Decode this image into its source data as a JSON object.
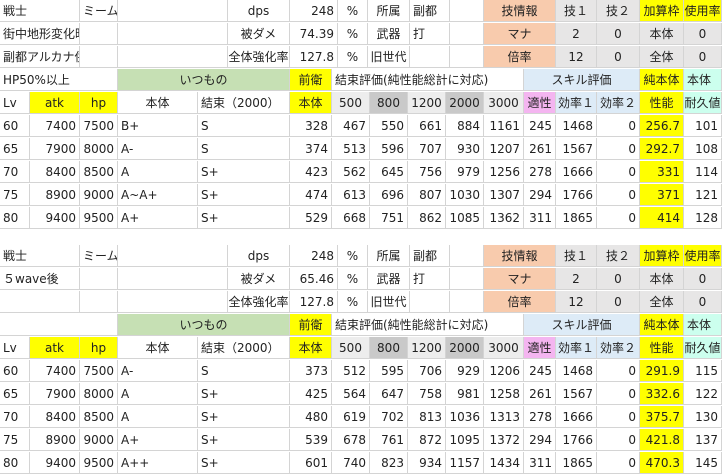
{
  "colors": {
    "peach": "#f8cbad",
    "grey": "#e7e6e6",
    "green": "#c6e0b4",
    "yellow": "#ffff00",
    "blue": "#ddebf7",
    "pink": "#f4b5f0",
    "mint": "#ccffee",
    "darkgrey": "#c9c9c9",
    "lightgrey": "#ededed"
  },
  "block1": {
    "info_rows": [
      [
        "戦士",
        "ミーム",
        "",
        "dps",
        "248",
        "%",
        "所属",
        "副都",
        "",
        "技情報",
        "技１",
        "技２",
        "加算枠",
        "使用率"
      ],
      [
        "街中地形変化時",
        "",
        "",
        "被ダメ",
        "74.39",
        "%",
        "武器",
        "打",
        "",
        "マナ",
        "2",
        "0",
        "本体",
        "0"
      ],
      [
        "副都アルカナ併用時",
        "",
        "",
        "全体強化率",
        "127.8",
        "%",
        "旧世代",
        "",
        "",
        "倍率",
        "12",
        "0",
        "全体",
        "0"
      ]
    ],
    "group_header": {
      "label": "HP50%以上",
      "itsumono": "いつもの",
      "zenei": "前衛",
      "kessoku": "結束評価(純性能総計に対応)",
      "skill": "スキル評価",
      "junsei": "純本体",
      "hontai": "本体"
    },
    "col_headers": [
      "Lv",
      "atk",
      "hp",
      "本体",
      "結束（2000）",
      "本体",
      "500",
      "800",
      "1200",
      "2000",
      "3000",
      "適性",
      "効率１",
      "効率２",
      "性能",
      "耐久値"
    ],
    "rows": [
      [
        "60",
        "7400",
        "7500",
        "B+",
        "S",
        "328",
        "467",
        "550",
        "661",
        "884",
        "1161",
        "245",
        "1468",
        "0",
        "256.7",
        "101"
      ],
      [
        "65",
        "7900",
        "8000",
        "A-",
        "S",
        "374",
        "513",
        "596",
        "707",
        "930",
        "1207",
        "261",
        "1567",
        "0",
        "292.7",
        "108"
      ],
      [
        "70",
        "8400",
        "8500",
        "A",
        "S+",
        "423",
        "562",
        "645",
        "756",
        "979",
        "1256",
        "278",
        "1666",
        "0",
        "331",
        "114"
      ],
      [
        "75",
        "8900",
        "9000",
        "A~A+",
        "S+",
        "474",
        "613",
        "696",
        "807",
        "1030",
        "1307",
        "294",
        "1766",
        "0",
        "371",
        "121"
      ],
      [
        "80",
        "9400",
        "9500",
        "A+",
        "S+",
        "529",
        "668",
        "751",
        "862",
        "1085",
        "1362",
        "311",
        "1865",
        "0",
        "414",
        "128"
      ]
    ]
  },
  "block2": {
    "info_rows": [
      [
        "戦士",
        "ミーム",
        "",
        "dps",
        "248",
        "%",
        "所属",
        "副都",
        "",
        "技情報",
        "技１",
        "技２",
        "加算枠",
        "使用率"
      ],
      [
        "５wave後",
        "",
        "",
        "被ダメ",
        "65.46",
        "%",
        "武器",
        "打",
        "",
        "マナ",
        "2",
        "0",
        "本体",
        "0"
      ],
      [
        "",
        "",
        "",
        "全体強化率",
        "127.8",
        "%",
        "旧世代",
        "",
        "",
        "倍率",
        "12",
        "0",
        "全体",
        "0"
      ]
    ],
    "group_header": {
      "label": "",
      "itsumono": "いつもの",
      "zenei": "前衛",
      "kessoku": "結束評価(純性能総計に対応)",
      "skill": "スキル評価",
      "junsei": "純本体",
      "hontai": "本体"
    },
    "col_headers": [
      "Lv",
      "atk",
      "hp",
      "本体",
      "結束（2000）",
      "本体",
      "500",
      "800",
      "1200",
      "2000",
      "3000",
      "適性",
      "効率１",
      "効率２",
      "性能",
      "耐久値"
    ],
    "rows": [
      [
        "60",
        "7400",
        "7500",
        "A-",
        "S",
        "373",
        "512",
        "595",
        "706",
        "929",
        "1206",
        "245",
        "1468",
        "0",
        "291.9",
        "115"
      ],
      [
        "65",
        "7900",
        "8000",
        "A",
        "S+",
        "425",
        "564",
        "647",
        "758",
        "981",
        "1258",
        "261",
        "1567",
        "0",
        "332.6",
        "122"
      ],
      [
        "70",
        "8400",
        "8500",
        "A",
        "S+",
        "480",
        "619",
        "702",
        "813",
        "1036",
        "1313",
        "278",
        "1666",
        "0",
        "375.7",
        "130"
      ],
      [
        "75",
        "8900",
        "9000",
        "A+",
        "S+",
        "539",
        "678",
        "761",
        "872",
        "1095",
        "1372",
        "294",
        "1766",
        "0",
        "421.8",
        "137"
      ],
      [
        "80",
        "9400",
        "9500",
        "A++",
        "S+",
        "601",
        "740",
        "823",
        "934",
        "1157",
        "1434",
        "311",
        "1865",
        "0",
        "470.3",
        "145"
      ]
    ]
  }
}
